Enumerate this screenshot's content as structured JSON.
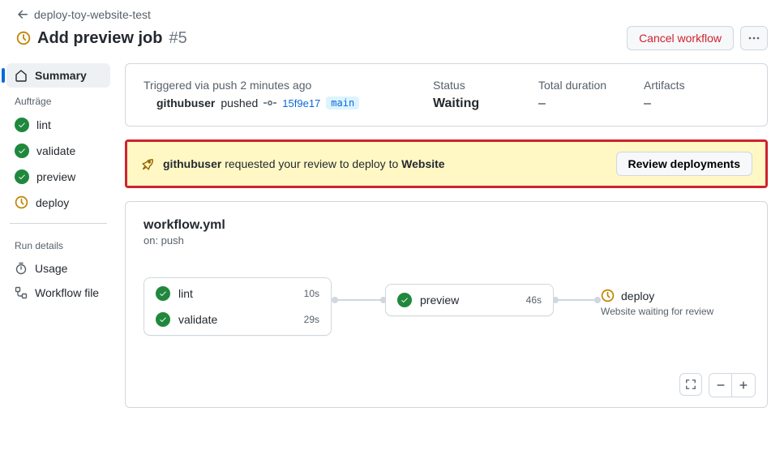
{
  "breadcrumb": {
    "repo": "deploy-toy-website-test"
  },
  "title": {
    "name": "Add preview job",
    "run_number": "#5"
  },
  "actions": {
    "cancel": "Cancel workflow"
  },
  "sidebar": {
    "summary": "Summary",
    "jobs_heading": "Aufträge",
    "jobs": [
      {
        "name": "lint",
        "status": "success"
      },
      {
        "name": "validate",
        "status": "success"
      },
      {
        "name": "preview",
        "status": "success"
      },
      {
        "name": "deploy",
        "status": "waiting"
      }
    ],
    "details_heading": "Run details",
    "usage": "Usage",
    "workflow_file": "Workflow file"
  },
  "meta": {
    "trigger_line": "Triggered via push 2 minutes ago",
    "actor": "githubuser",
    "action_word": "pushed",
    "sha": "15f9e17",
    "branch": "main",
    "status_label": "Status",
    "status_value": "Waiting",
    "duration_label": "Total duration",
    "duration_value": "–",
    "artifacts_label": "Artifacts",
    "artifacts_value": "–"
  },
  "review": {
    "actor": "githubuser",
    "mid_text": "requested your review to deploy to",
    "env": "Website",
    "button": "Review deployments"
  },
  "workflow": {
    "file": "workflow.yml",
    "on": "on: push",
    "nodes": {
      "lint": {
        "name": "lint",
        "duration": "10s"
      },
      "validate": {
        "name": "validate",
        "duration": "29s"
      },
      "preview": {
        "name": "preview",
        "duration": "46s"
      },
      "deploy": {
        "name": "deploy",
        "sub": "Website waiting for review"
      }
    }
  }
}
